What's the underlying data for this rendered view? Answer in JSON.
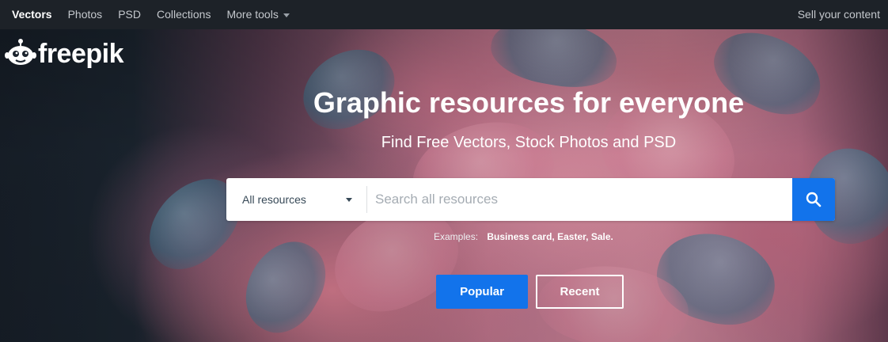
{
  "topnav": {
    "items": [
      {
        "label": "Vectors",
        "active": true
      },
      {
        "label": "Photos",
        "active": false
      },
      {
        "label": "PSD",
        "active": false
      },
      {
        "label": "Collections",
        "active": false
      },
      {
        "label": "More tools",
        "active": false
      }
    ],
    "sell_label": "Sell your content"
  },
  "logo": {
    "text": "freepik"
  },
  "hero": {
    "title": "Graphic resources for everyone",
    "subtitle": "Find Free Vectors, Stock Photos and PSD"
  },
  "search": {
    "scope_selected": "All resources",
    "placeholder": "Search all resources",
    "value": ""
  },
  "examples": {
    "label": "Examples:",
    "items": [
      "Business card,",
      "Easter,",
      "Sale."
    ]
  },
  "buttons": {
    "popular_label": "Popular",
    "recent_label": "Recent"
  },
  "colors": {
    "accent": "#1273eb",
    "nav_bg": "#1d2228"
  },
  "icons": {
    "logo_mark": "freepik-logo-icon",
    "search": "search-icon",
    "dropdown": "chevron-down-icon"
  }
}
